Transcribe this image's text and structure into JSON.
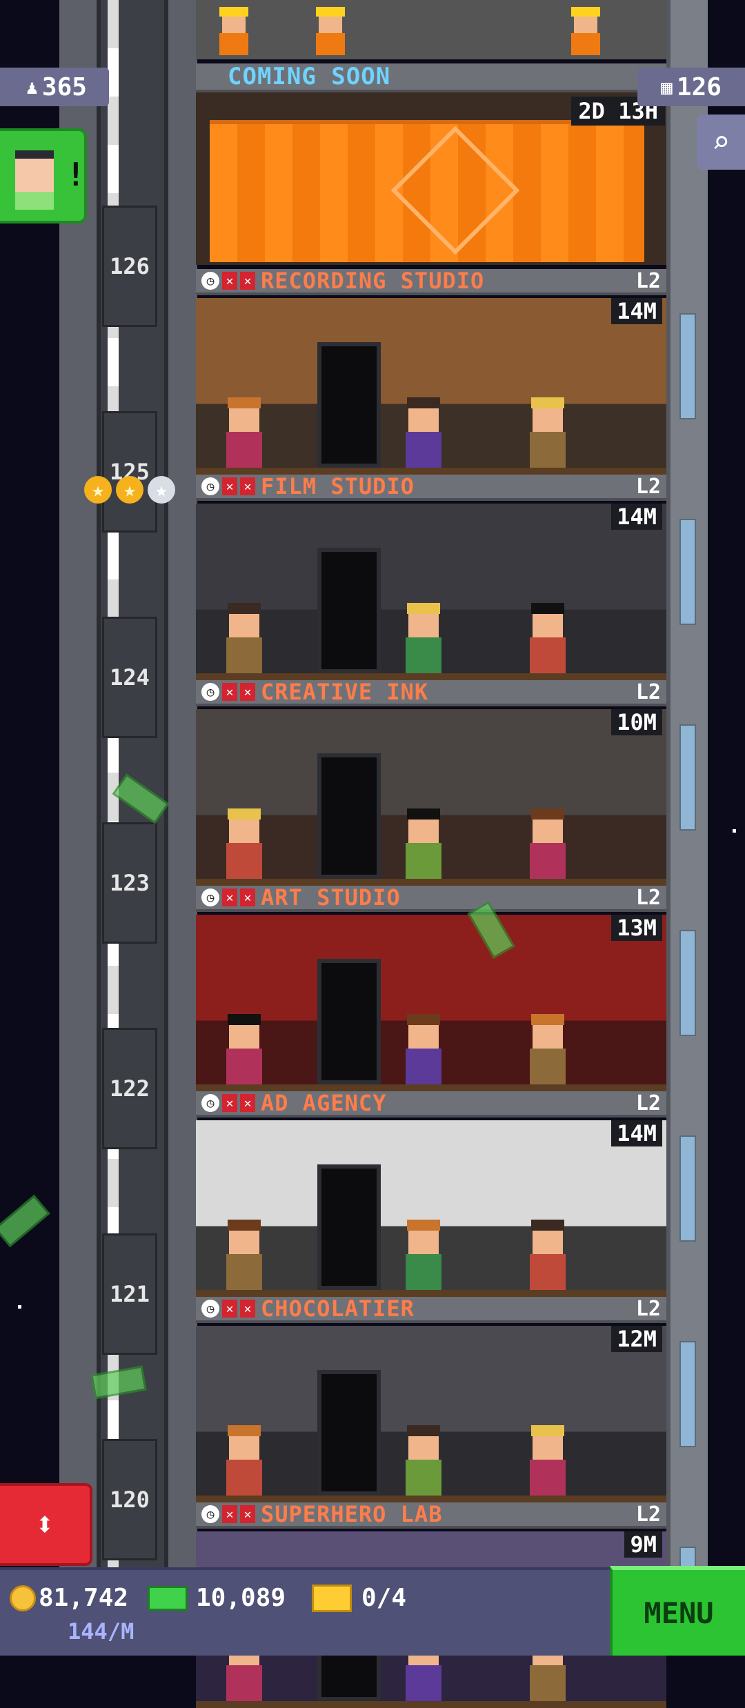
{
  "badges": {
    "population": "365",
    "floors": "126"
  },
  "construction": {
    "label": "COMING SOON",
    "timer": "2D 13H"
  },
  "floors": [
    {
      "number": "126",
      "name": "RECORDING STUDIO",
      "level": "L2",
      "timer": "14M",
      "bg": "#3d3026",
      "wall": "#8a5a32"
    },
    {
      "number": "125",
      "name": "FILM STUDIO",
      "level": "L2",
      "timer": "14M",
      "bg": "#2b2b30",
      "wall": "#3a3a40"
    },
    {
      "number": "124",
      "name": "CREATIVE INK",
      "level": "L2",
      "timer": "10M",
      "bg": "#3b2a24",
      "wall": "#4a4542"
    },
    {
      "number": "123",
      "name": "ART STUDIO",
      "level": "L2",
      "timer": "13M",
      "bg": "#4a1616",
      "wall": "#8c1f1c"
    },
    {
      "number": "122",
      "name": "AD AGENCY",
      "level": "L2",
      "timer": "14M",
      "bg": "#3a3a3a",
      "wall": "#d9d9d9"
    },
    {
      "number": "121",
      "name": "CHOCOLATIER",
      "level": "L2",
      "timer": "12M",
      "bg": "#2c2c30",
      "wall": "#4a4a50"
    },
    {
      "number": "120",
      "name": "SUPERHERO LAB",
      "level": "L2",
      "timer": "9M",
      "bg": "#2d2440",
      "wall": "#5a4f74"
    }
  ],
  "bottom": {
    "coins": "81,742",
    "bux": "10,089",
    "tickets": "0/4",
    "income": "144/M",
    "menu_label": "MENU"
  },
  "colors": {
    "floor_name": "#ff7d4a",
    "coming_soon": "#6fd3ff",
    "menu": "#2cc433",
    "bottom_bar": "#4f5176"
  }
}
